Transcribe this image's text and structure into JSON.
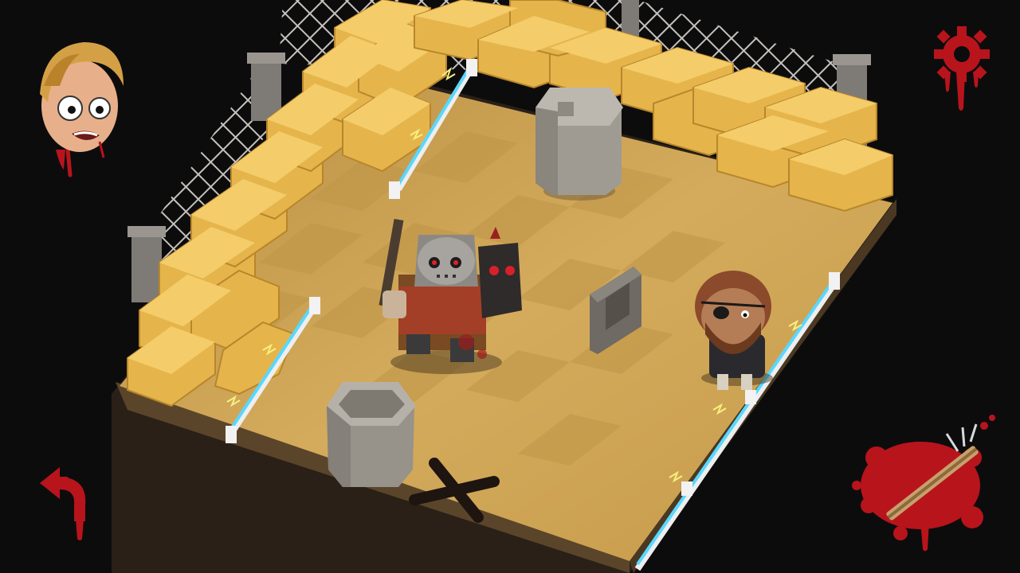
{
  "game": {
    "level_objects": {
      "killer": "masked-killer-with-machete",
      "victim": "bearded-eyepatch-victim",
      "goal_marker": "x-exit-marker",
      "obstacles": [
        "trash-can",
        "barrel-pot",
        "gravestone",
        "hay-bales",
        "electric-fences"
      ]
    }
  },
  "hud": {
    "portrait": "scared-victim-portrait",
    "settings": "gear-icon",
    "undo": "undo-arrow-icon",
    "weapon": "machete-weapon-icon"
  },
  "colors": {
    "background": "#0d0c0d",
    "floor": "#c9a458",
    "floor_dark": "#b89446",
    "hay": "#e8b84f",
    "blood": "#b8141c",
    "electric": "#58d8ff"
  }
}
